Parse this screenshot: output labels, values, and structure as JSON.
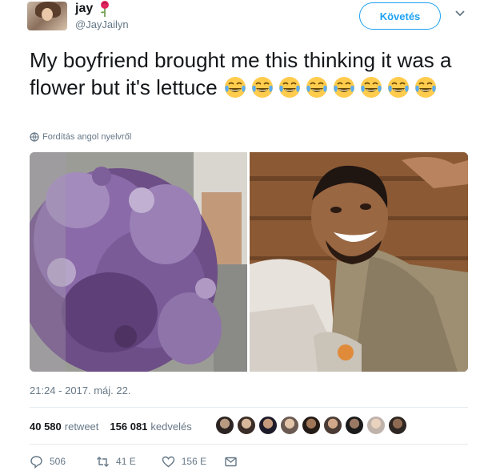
{
  "user": {
    "display_name": "jay",
    "handle": "@JayJailyn",
    "name_emoji_icon": "rose-icon"
  },
  "follow_button_label": "Követés",
  "tweet": {
    "text": "My boyfriend brought me this thinking it was a flower but it's lettuce",
    "emoji_icon": "face-with-tears-of-joy-icon",
    "emoji_count": 8
  },
  "translate_label": "Fordítás angol nyelvről",
  "media": {
    "left_photo_icon": "purple-ornamental-cabbage-photo",
    "right_photo_icon": "smiling-boyfriend-photo"
  },
  "timestamp": "21:24 - 2017. máj. 22.",
  "stats": {
    "retweet_count": "40 580",
    "retweet_label": "retweet",
    "like_count": "156 081",
    "like_label": "kedvelés"
  },
  "actions": {
    "reply_count": "506",
    "retweet_count": "41 E",
    "like_count": "156 E"
  },
  "colors": {
    "accent": "#1da1f2",
    "text_primary": "#14171a",
    "text_secondary": "#657786",
    "rose": "#e0245e"
  }
}
